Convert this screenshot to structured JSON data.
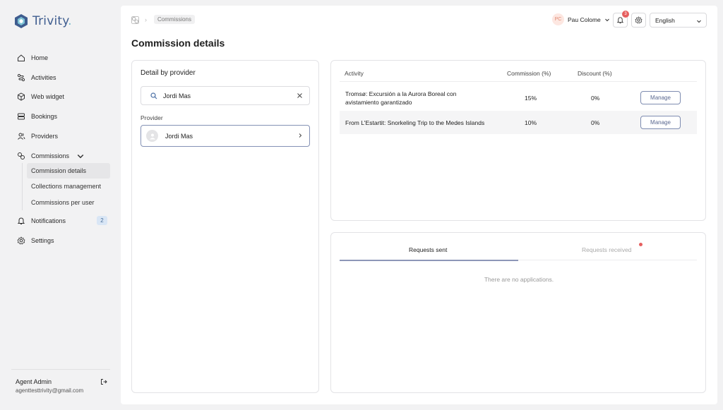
{
  "app": {
    "name": "Trivity",
    "name_suffix": ".",
    "brand_color": "#3f5d8f",
    "accent_color": "#6fb7c9"
  },
  "sidebar": {
    "items": [
      {
        "label": "Home",
        "icon": "home-icon"
      },
      {
        "label": "Activities",
        "icon": "route-icon"
      },
      {
        "label": "Web widget",
        "icon": "cube-icon"
      },
      {
        "label": "Bookings",
        "icon": "bookings-icon"
      },
      {
        "label": "Providers",
        "icon": "users-icon"
      },
      {
        "label": "Commissions",
        "icon": "commissions-icon",
        "expanded": true
      },
      {
        "label": "Notifications",
        "icon": "bell-icon",
        "badge": "2"
      },
      {
        "label": "Settings",
        "icon": "gear-icon"
      }
    ],
    "subitems": [
      {
        "label": "Commission details",
        "active": true
      },
      {
        "label": "Collections management"
      },
      {
        "label": "Commissions per user"
      }
    ],
    "user": {
      "name": "Agent Admin",
      "email": "agenttesttrivity@gmail.com"
    }
  },
  "header": {
    "breadcrumb": "Commissions",
    "profile": {
      "initials": "PC",
      "name": "Pau Colome"
    },
    "notifications_count": "3",
    "language": "English"
  },
  "page": {
    "title": "Commission details"
  },
  "provider_panel": {
    "title": "Detail by provider",
    "search_value": "Jordi Mas",
    "provider_label": "Provider",
    "providers": [
      {
        "name": "Jordi Mas"
      }
    ]
  },
  "activity_table": {
    "columns": {
      "activity": "Activity",
      "commission": "Commission (%)",
      "discount": "Discount (%)"
    },
    "rows": [
      {
        "activity_line1": "Tromsø: Excursión a la Aurora Boreal con",
        "activity_line2": "avistamiento garantizado",
        "commission": "15%",
        "discount": "0%",
        "action": "Manage"
      },
      {
        "activity_line1": "From L'Estartit: Snorkeling Trip to the Medes Islands",
        "activity_line2": "",
        "commission": "10%",
        "discount": "0%",
        "action": "Manage"
      }
    ]
  },
  "requests": {
    "tabs": {
      "sent": "Requests sent",
      "received": "Requests received"
    },
    "empty_message": "There are no applications."
  }
}
